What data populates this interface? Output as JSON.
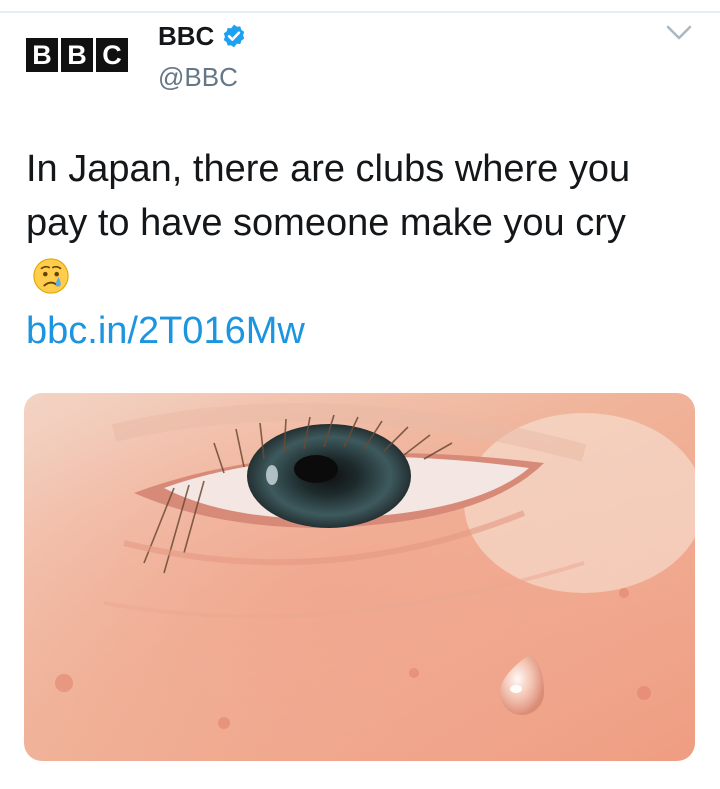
{
  "account": {
    "logo_letters": [
      "B",
      "B",
      "C"
    ],
    "display_name": "BBC",
    "handle": "@BBC",
    "verified": true
  },
  "tweet": {
    "text": "In Japan, there are clubs where you pay to have someone make you cry",
    "emoji": "crying-face",
    "link": "bbc.in/2T016Mw"
  },
  "icons": {
    "verified": "verified-badge-icon",
    "menu": "chevron-down-icon"
  },
  "colors": {
    "link": "#1b95e0",
    "verified": "#1da1f2",
    "handle": "#657786"
  }
}
